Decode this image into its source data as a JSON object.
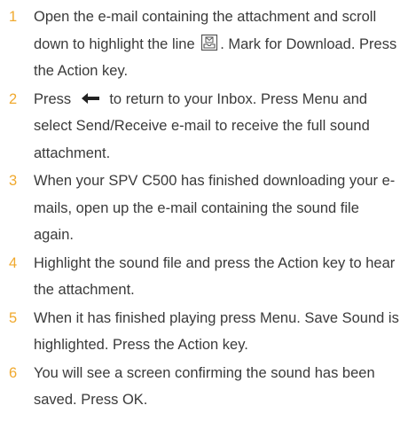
{
  "steps": [
    {
      "number": "1",
      "text_before": "Open the e-mail containing the attachment and scroll down to highlight the line ",
      "icon": "attachment-icon",
      "text_after": ". Mark for Download. Press the Action key."
    },
    {
      "number": "2",
      "text_before": "Press ",
      "icon": "arrow-left-icon",
      "text_after": " to return to your Inbox. Press Menu and select Send/Receive e-mail to receive the full sound attachment."
    },
    {
      "number": "3",
      "text": "When your SPV C500 has finished downloading your e-mails, open up the e-mail containing the sound file again."
    },
    {
      "number": "4",
      "text": "Highlight the sound file and press the Action key to hear the attachment."
    },
    {
      "number": "5",
      "text": "When it has finished playing press Menu. Save Sound is highlighted. Press the Action key."
    },
    {
      "number": "6",
      "text": "You will see a screen confirming the sound has been saved. Press OK."
    }
  ],
  "colors": {
    "number": "#f0a92e",
    "text": "#3a3a3a"
  }
}
